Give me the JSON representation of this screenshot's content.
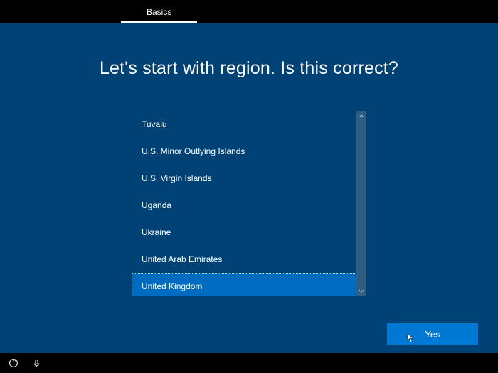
{
  "topbar": {
    "tab_label": "Basics"
  },
  "heading": "Let's start with region. Is this correct?",
  "regions": {
    "items": [
      "Tuvalu",
      "U.S. Minor Outlying Islands",
      "U.S. Virgin Islands",
      "Uganda",
      "Ukraine",
      "United Arab Emirates",
      "United Kingdom"
    ],
    "selected_index": 6
  },
  "confirm_button": "Yes",
  "icons": {
    "scroll_up": "chevron-up-icon",
    "scroll_down": "chevron-down-icon",
    "ease_of_access": "accessibility-icon",
    "audio": "microphone-icon"
  },
  "colors": {
    "background": "#004275",
    "accent": "#0078d4",
    "selected": "#006cc1"
  }
}
